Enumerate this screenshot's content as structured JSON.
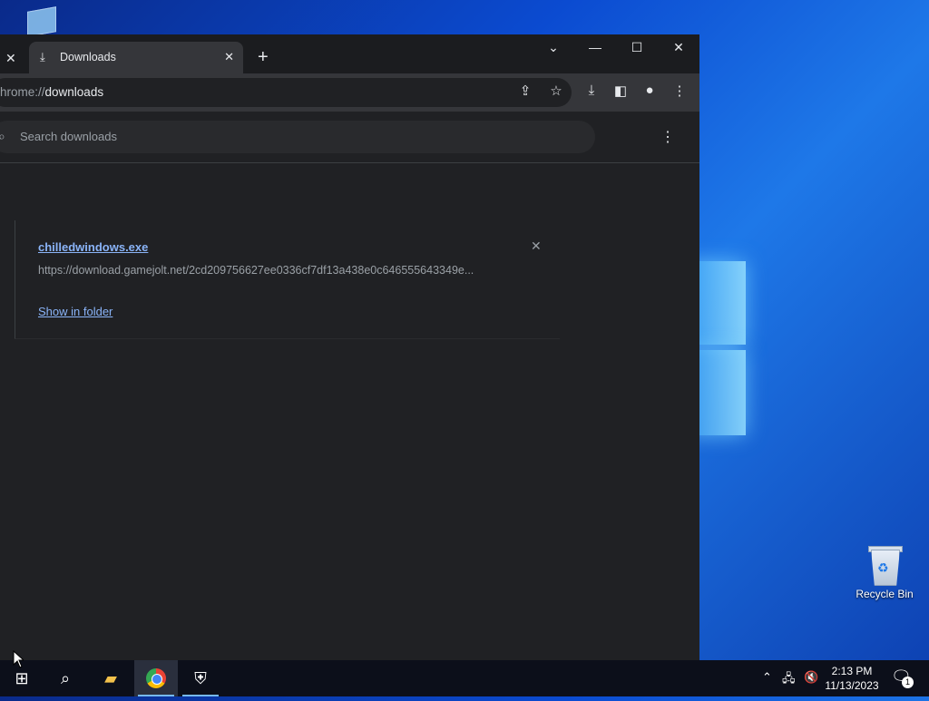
{
  "desktop": {
    "recycle_bin_label": "Recycle Bin"
  },
  "browser": {
    "tab_title": "Downloads",
    "new_tab_symbol": "+",
    "url_scheme": "hrome://",
    "url_path": "downloads",
    "search_placeholder": "Search downloads",
    "download": {
      "file_name": "chilledwindows.exe",
      "file_url": "https://download.gamejolt.net/2cd209756627ee0336cf7df13a438e0c646555643349e...",
      "show_in_folder": "Show in folder"
    }
  },
  "taskbar": {
    "time": "2:13 PM",
    "date": "11/13/2023",
    "notification_count": "1"
  },
  "colors": {
    "accent_link": "#8ab4f8",
    "browser_bg": "#202124",
    "taskbar_bg": "#0c0f1a"
  }
}
